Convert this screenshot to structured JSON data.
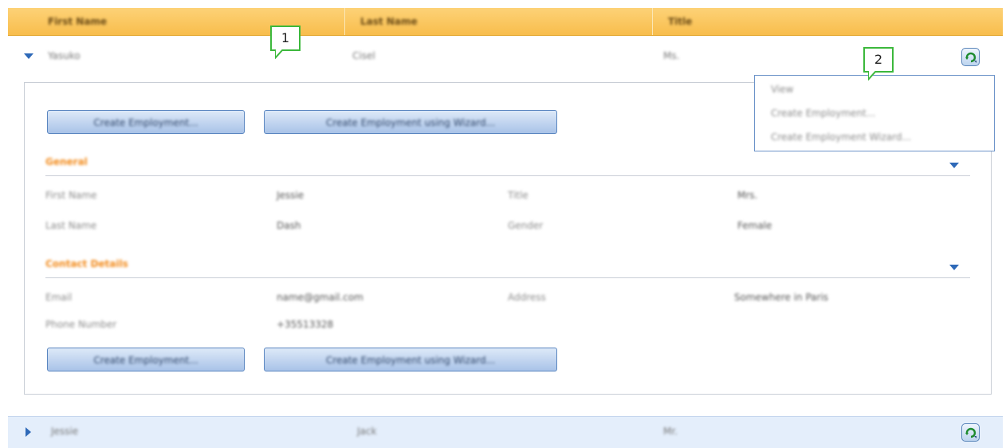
{
  "header": {
    "columns": [
      "First Name",
      "Last Name",
      "Title"
    ]
  },
  "rows": [
    {
      "first": "Yasuko",
      "last": "Cisel",
      "title": "Ms.",
      "expanded": true
    },
    {
      "first": "Jessie",
      "last": "Jack",
      "title": "Mr.",
      "expanded": false
    }
  ],
  "detail": {
    "top_buttons": [
      "Create Employment...",
      "Create Employment using Wizard..."
    ],
    "bottom_buttons": [
      "Create Employment...",
      "Create Employment using Wizard..."
    ],
    "general": {
      "title": "General",
      "fields": [
        {
          "label": "First Name",
          "value": "Jessie"
        },
        {
          "label": "Title",
          "value": "Mrs."
        },
        {
          "label": "Last Name",
          "value": "Dash"
        },
        {
          "label": "Gender",
          "value": "Female"
        }
      ]
    },
    "contact": {
      "title": "Contact Details",
      "fields": [
        {
          "label": "Email",
          "value": "name@gmail.com"
        },
        {
          "label": "Address",
          "value": "Somewhere in Paris"
        },
        {
          "label": "Phone Number",
          "value": "+35513328"
        }
      ]
    }
  },
  "menu": {
    "items": [
      "View",
      "Create Employment...",
      "Create Employment Wizard..."
    ]
  },
  "callouts": [
    "1",
    "2"
  ],
  "colors": {
    "header": "#f8bd4c",
    "accent": "#2e69b8",
    "section": "#f28a1a",
    "callout": "#3cb83c"
  }
}
